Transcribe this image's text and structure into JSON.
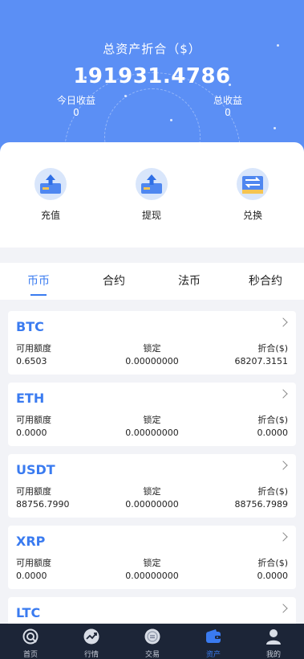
{
  "header": {
    "title": "总资产折合（$）",
    "total_value": "191931.4786",
    "today_label": "今日收益",
    "today_value": "0",
    "total_income_label": "总收益",
    "total_income_value": "0"
  },
  "actions": [
    {
      "label": "充值",
      "icon": "upload-tray-icon"
    },
    {
      "label": "提现",
      "icon": "upload-tray-icon"
    },
    {
      "label": "兑换",
      "icon": "exchange-arrows-icon"
    }
  ],
  "tabs": [
    {
      "label": "币币",
      "active": true
    },
    {
      "label": "合约",
      "active": false
    },
    {
      "label": "法币",
      "active": false
    },
    {
      "label": "秒合约",
      "active": false
    }
  ],
  "column_labels": {
    "available": "可用额度",
    "locked": "锁定",
    "converted": "折合($)"
  },
  "assets": [
    {
      "symbol": "BTC",
      "available": "0.6503",
      "locked": "0.00000000",
      "converted": "68207.3151"
    },
    {
      "symbol": "ETH",
      "available": "0.0000",
      "locked": "0.00000000",
      "converted": "0.0000"
    },
    {
      "symbol": "USDT",
      "available": "88756.7990",
      "locked": "0.00000000",
      "converted": "88756.7989"
    },
    {
      "symbol": "XRP",
      "available": "0.0000",
      "locked": "0.00000000",
      "converted": "0.0000"
    },
    {
      "symbol": "LTC"
    }
  ],
  "nav": [
    {
      "label": "首页",
      "icon": "home-icon",
      "active": false
    },
    {
      "label": "行情",
      "icon": "market-chart-icon",
      "active": false
    },
    {
      "label": "交易",
      "icon": "trade-icon",
      "active": false
    },
    {
      "label": "资产",
      "icon": "wallet-icon",
      "active": true
    },
    {
      "label": "我的",
      "icon": "user-icon",
      "active": false
    }
  ],
  "colors": {
    "accent": "#3a7bf0",
    "hero": "#5b8ff5",
    "navbar": "#1c2537"
  }
}
